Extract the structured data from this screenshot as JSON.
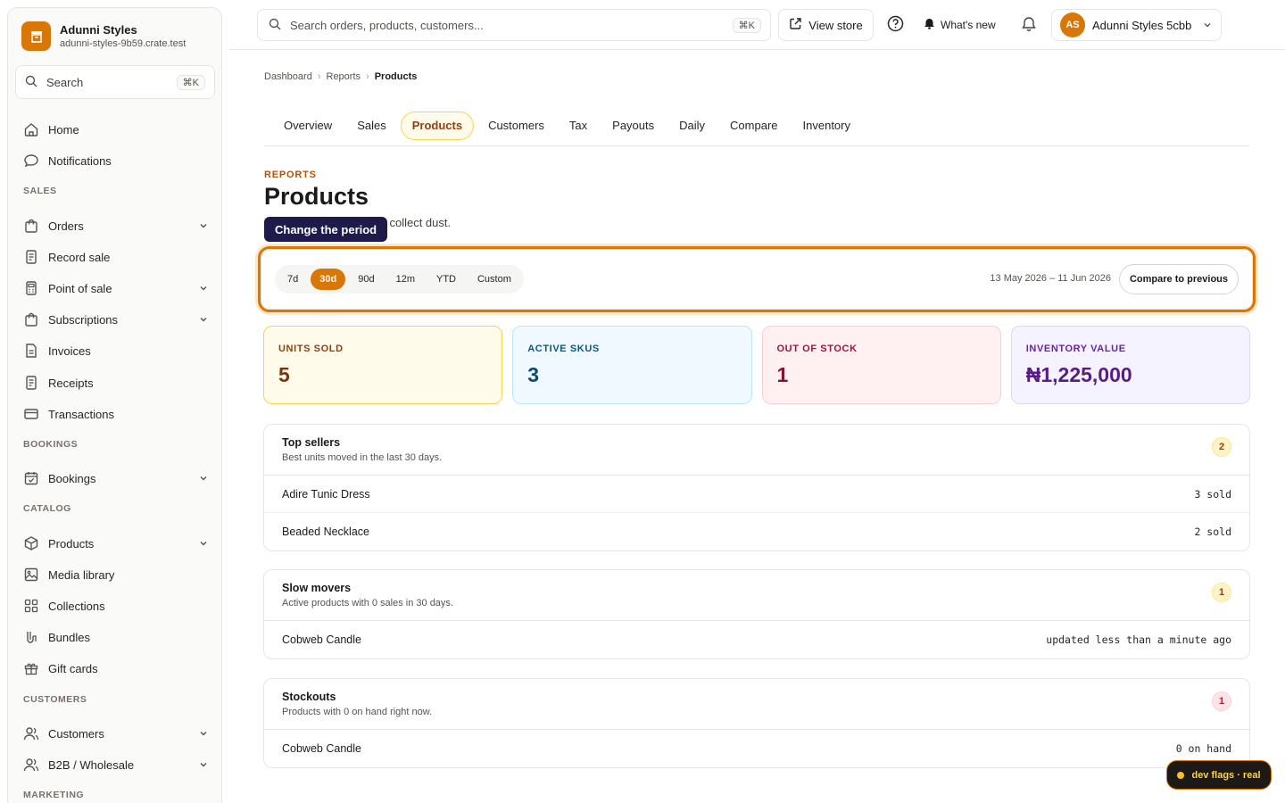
{
  "brand": {
    "name": "Adunni Styles",
    "domain": "adunni-styles-9b59.crate.test"
  },
  "sidebar": {
    "search_label": "Search",
    "search_kbd": "⌘K",
    "top_items": [
      {
        "label": "Home",
        "icon": "home-icon"
      },
      {
        "label": "Notifications",
        "icon": "chat-bubble-icon"
      }
    ],
    "sections": [
      {
        "title": "SALES",
        "items": [
          {
            "label": "Orders",
            "icon": "bag-icon",
            "expandable": true
          },
          {
            "label": "Record sale",
            "icon": "receipt-icon",
            "expandable": false
          },
          {
            "label": "Point of sale",
            "icon": "terminal-icon",
            "expandable": true
          },
          {
            "label": "Subscriptions",
            "icon": "bag-icon",
            "expandable": true
          },
          {
            "label": "Invoices",
            "icon": "document-icon",
            "expandable": false
          },
          {
            "label": "Receipts",
            "icon": "receipt-icon",
            "expandable": false
          },
          {
            "label": "Transactions",
            "icon": "card-icon",
            "expandable": false
          }
        ]
      },
      {
        "title": "BOOKINGS",
        "items": [
          {
            "label": "Bookings",
            "icon": "calendar-icon",
            "expandable": true
          }
        ]
      },
      {
        "title": "CATALOG",
        "items": [
          {
            "label": "Products",
            "icon": "box-icon",
            "expandable": true
          },
          {
            "label": "Media library",
            "icon": "image-icon",
            "expandable": false
          },
          {
            "label": "Collections",
            "icon": "grid-icon",
            "expandable": false
          },
          {
            "label": "Bundles",
            "icon": "bundle-icon",
            "expandable": false
          },
          {
            "label": "Gift cards",
            "icon": "gift-icon",
            "expandable": false
          }
        ]
      },
      {
        "title": "CUSTOMERS",
        "items": [
          {
            "label": "Customers",
            "icon": "users-icon",
            "expandable": true
          },
          {
            "label": "B2B / Wholesale",
            "icon": "users-icon",
            "expandable": true
          }
        ]
      },
      {
        "title": "MARKETING",
        "items": []
      }
    ]
  },
  "topbar": {
    "search_placeholder": "Search orders, products, customers...",
    "search_kbd": "⌘K",
    "view_store": "View store",
    "whats_new": "What's new",
    "avatar_initials": "AS",
    "account_name": "Adunni Styles 5cbb"
  },
  "breadcrumb": [
    "Dashboard",
    "Reports",
    "Products"
  ],
  "tabs": [
    "Overview",
    "Sales",
    "Products",
    "Customers",
    "Tax",
    "Payouts",
    "Daily",
    "Compare",
    "Inventory"
  ],
  "active_tab": "Products",
  "header": {
    "eyebrow": "REPORTS",
    "title": "Products",
    "subtitle_visible": "hich collect dust.",
    "tooltip": "Change the period"
  },
  "period": {
    "options": [
      "7d",
      "30d",
      "90d",
      "12m",
      "YTD",
      "Custom"
    ],
    "selected": "30d",
    "range": "13 May 2026 – 11 Jun 2026",
    "compare_label": "Compare to previous"
  },
  "kpis": [
    {
      "label": "UNITS SOLD",
      "value": "5",
      "tone": "amber"
    },
    {
      "label": "ACTIVE SKUS",
      "value": "3",
      "tone": "blue"
    },
    {
      "label": "OUT OF STOCK",
      "value": "1",
      "tone": "red"
    },
    {
      "label": "INVENTORY VALUE",
      "value": "₦1,225,000",
      "tone": "purple"
    }
  ],
  "cards": [
    {
      "title": "Top sellers",
      "subtitle": "Best units moved in the last 30 days.",
      "count": "2",
      "tone": "amber",
      "rows": [
        {
          "name": "Adire Tunic Dress",
          "meta": "3 sold"
        },
        {
          "name": "Beaded Necklace",
          "meta": "2 sold"
        }
      ]
    },
    {
      "title": "Slow movers",
      "subtitle": "Active products with 0 sales in 30 days.",
      "count": "1",
      "tone": "amber",
      "rows": [
        {
          "name": "Cobweb Candle",
          "meta": "updated less than a minute ago"
        }
      ]
    },
    {
      "title": "Stockouts",
      "subtitle": "Products with 0 on hand right now.",
      "count": "1",
      "tone": "rose",
      "rows": [
        {
          "name": "Cobweb Candle",
          "meta": "0 on hand"
        }
      ]
    }
  ],
  "dev_flags": "dev flags · real",
  "colors": {
    "accent": "#d97706",
    "tooltip": "#1e1b4b"
  }
}
